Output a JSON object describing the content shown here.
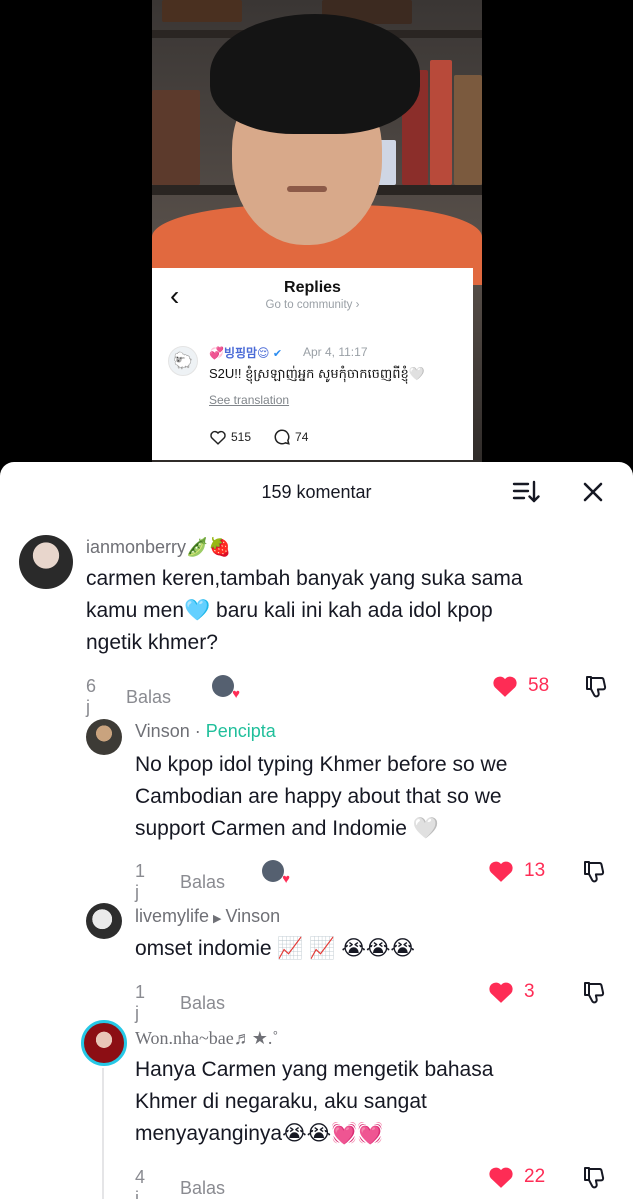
{
  "replies_card": {
    "title": "Replies",
    "subtitle": "Go to community ›",
    "name": "💞빙핑맘😌",
    "verified": "✔",
    "date": "Apr 4, 11:17",
    "text": "S2U!! ខ្ញុំស្រឡាញ់អ្នក សូមកុំចាកចេញពីខ្ញុំ🤍",
    "translate": "See translation",
    "likes": "515",
    "comments": "74"
  },
  "sheet": {
    "title": "159 komentar"
  },
  "comments": [
    {
      "name": "ianmonberry🫛🍓",
      "text_lines": [
        "carmen keren,tambah banyak yang suka sama",
        "kamu men🩵 baru kali ini kah ada idol kpop",
        "ngetik khmer?"
      ],
      "time": "6 j",
      "reply": "Balas",
      "likes": "58"
    },
    {
      "name": "Vinson",
      "sep": " · ",
      "badge": "Pencipta",
      "text_lines": [
        "No kpop idol typing Khmer before so we",
        "Cambodian are happy about that so we",
        "support Carmen and Indomie 🤍"
      ],
      "time": "1 j",
      "reply": "Balas",
      "likes": "13"
    },
    {
      "name": "livemylife",
      "reply_to": "Vinson",
      "text_lines": [
        "omset indomie 📈 📈  😭😭😭"
      ],
      "time": "1 j",
      "reply": "Balas",
      "likes": "3"
    },
    {
      "name": "Won.nha~bae♬★.˚",
      "text_lines": [
        "Hanya Carmen yang mengetik bahasa",
        "Khmer di negaraku, aku sangat",
        "menyayanginya😭😭💓💓"
      ],
      "time": "4 j",
      "reply": "Balas",
      "likes": "22"
    }
  ],
  "colors": {
    "accent_like": "#fe2c55",
    "creator_badge": "#20bf9b"
  }
}
